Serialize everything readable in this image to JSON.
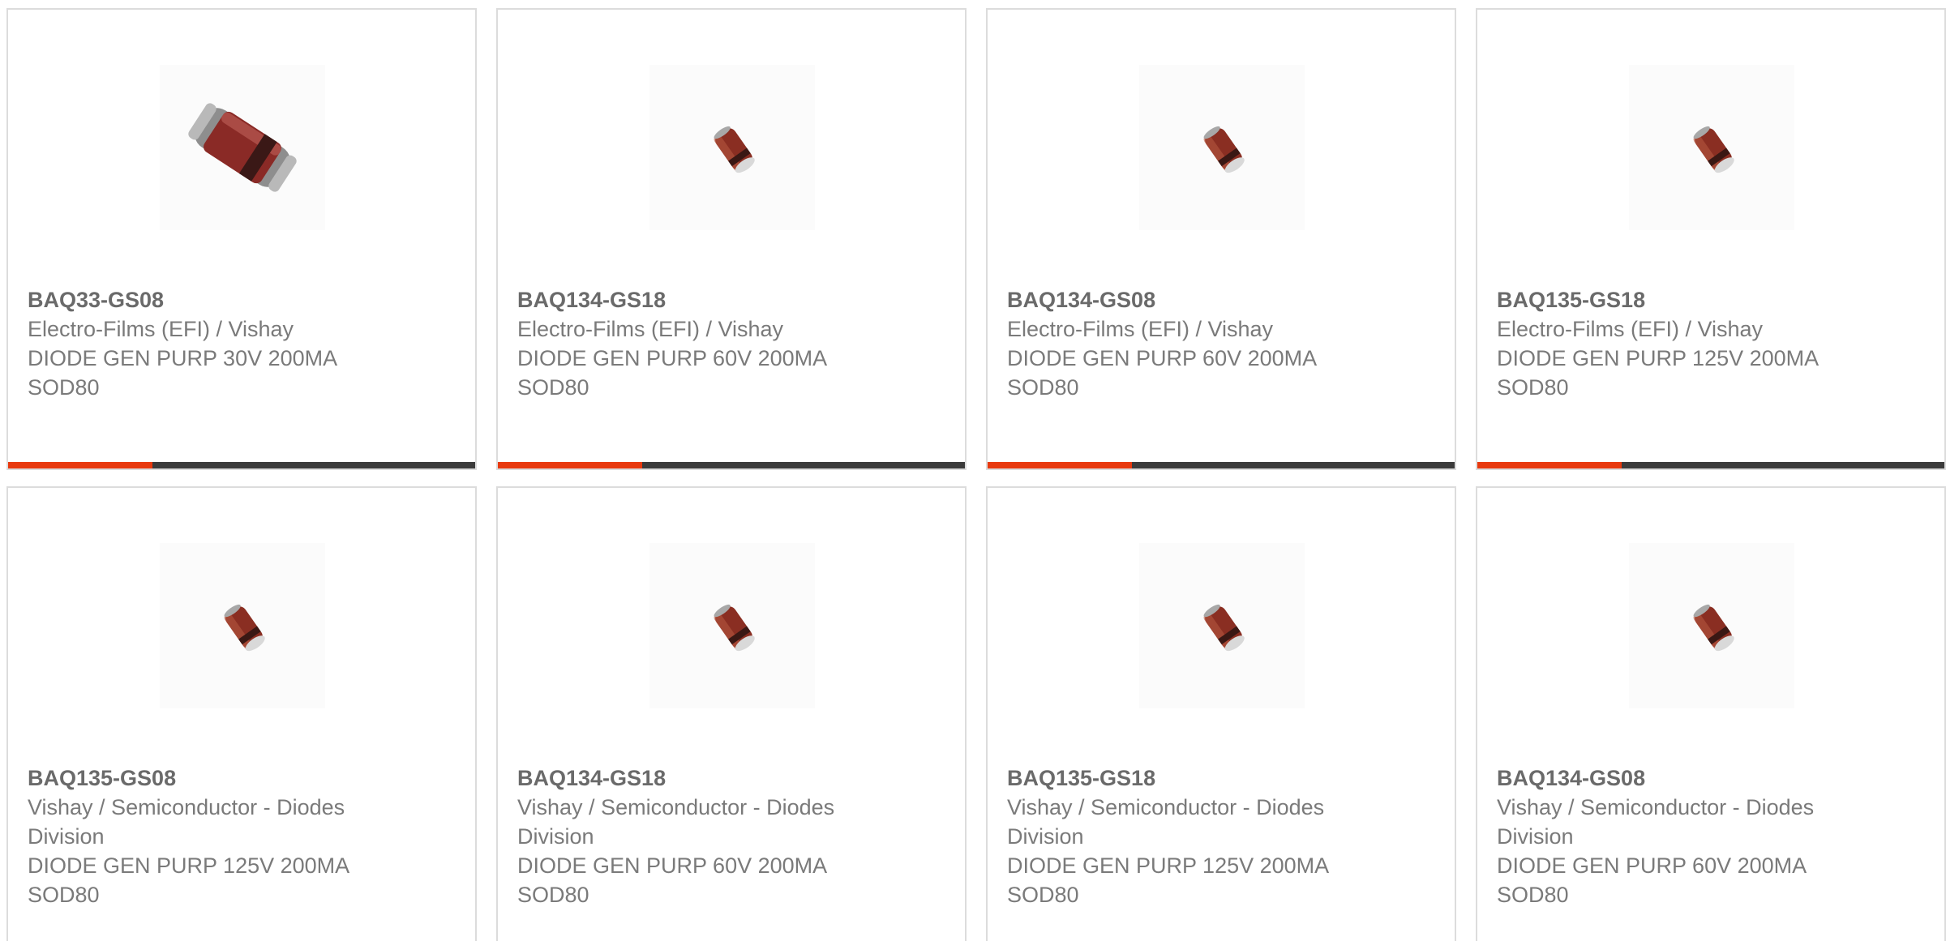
{
  "colors": {
    "accent": "#e8390e",
    "track": "#3b3b3b",
    "border": "#dcdcdc",
    "text": "#6a6a6a"
  },
  "cards": [
    {
      "part_number": "BAQ33-GS08",
      "manufacturer": "Electro-Films (EFI) / Vishay",
      "description": "DIODE GEN PURP 30V 200MA",
      "package": "SOD80",
      "image_icon": "diode-large-icon",
      "progress": 0.31
    },
    {
      "part_number": "BAQ134-GS18",
      "manufacturer": "Electro-Films (EFI) / Vishay",
      "description": "DIODE GEN PURP 60V 200MA",
      "package": "SOD80",
      "image_icon": "diode-small-icon",
      "progress": 0.31
    },
    {
      "part_number": "BAQ134-GS08",
      "manufacturer": "Electro-Films (EFI) / Vishay",
      "description": "DIODE GEN PURP 60V 200MA",
      "package": "SOD80",
      "image_icon": "diode-small-icon",
      "progress": 0.31
    },
    {
      "part_number": "BAQ135-GS18",
      "manufacturer": "Electro-Films (EFI) / Vishay",
      "description": "DIODE GEN PURP 125V 200MA",
      "package": "SOD80",
      "image_icon": "diode-small-icon",
      "progress": 0.31
    },
    {
      "part_number": "BAQ135-GS08",
      "manufacturer_line1": "Vishay / Semiconductor - Diodes",
      "manufacturer_line2": "Division",
      "description": "DIODE GEN PURP 125V 200MA",
      "package": "SOD80",
      "image_icon": "diode-small-icon"
    },
    {
      "part_number": "BAQ134-GS18",
      "manufacturer_line1": "Vishay / Semiconductor - Diodes",
      "manufacturer_line2": "Division",
      "description": "DIODE GEN PURP 60V 200MA",
      "package": "SOD80",
      "image_icon": "diode-small-icon"
    },
    {
      "part_number": "BAQ135-GS18",
      "manufacturer_line1": "Vishay / Semiconductor - Diodes",
      "manufacturer_line2": "Division",
      "description": "DIODE GEN PURP 125V 200MA",
      "package": "SOD80",
      "image_icon": "diode-small-icon"
    },
    {
      "part_number": "BAQ134-GS08",
      "manufacturer_line1": "Vishay / Semiconductor - Diodes",
      "manufacturer_line2": "Division",
      "description": "DIODE GEN PURP 60V 200MA",
      "package": "SOD80",
      "image_icon": "diode-small-icon"
    }
  ]
}
